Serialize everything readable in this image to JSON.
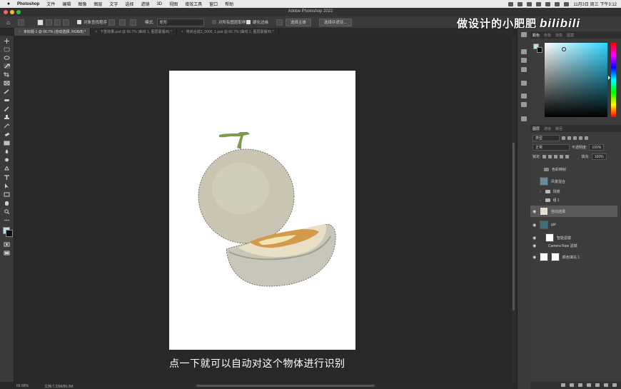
{
  "menubar": {
    "app": "Photoshop",
    "items": [
      "文件",
      "编辑",
      "图像",
      "图层",
      "文字",
      "选择",
      "滤镜",
      "3D",
      "视图",
      "增效工具",
      "窗口",
      "帮助"
    ],
    "clock": "11月3日 周三 下午3:12"
  },
  "window": {
    "title": "Adobe Photoshop 2022"
  },
  "options_bar": {
    "object_finder": "对象查找程序",
    "mode_label": "模式:",
    "mode_value": "矩形",
    "sample_all": "对所有图层取样",
    "harden_edge": "硬化边缘",
    "select_subject": "选择主体",
    "select_mask": "选择并遮住..."
  },
  "tabs": [
    {
      "label": "未标题-1 @ 66.7% (自动选择, RGB/8) *",
      "active": true
    },
    {
      "label": "下雪效果.psd @ 66.7% (曲线 1, 图层蒙版/8) *",
      "active": false
    },
    {
      "label": "电商合成2_0000_1.psd @ 66.7% (曲线 1, 图层蒙版/8) *",
      "active": false
    }
  ],
  "canvas": {
    "subtitle": "点一下就可以自动对这个物体进行识别"
  },
  "status": {
    "zoom": "66.68%",
    "doc": "文档:7.23M/89.0M"
  },
  "watermark": {
    "text": "做设计的小肥肥",
    "logo": "bilibili"
  },
  "color_panel": {
    "tabs": [
      "颜色",
      "色板",
      "渐变",
      "图案"
    ],
    "foreground": "#b8e2ec",
    "background": "#111111"
  },
  "layers_panel": {
    "tabs": [
      "图层",
      "通道",
      "路径"
    ],
    "filter_kind": "类型",
    "blend_mode": "正常",
    "opacity_label": "不透明度:",
    "opacity_value": "100%",
    "lock_label": "锁定:",
    "fill_label": "填充:",
    "fill_value": "100%",
    "layers": [
      {
        "name": "色彩映射",
        "kind": "adjust",
        "visible": false
      },
      {
        "name": "风景混合",
        "kind": "image",
        "visible": false
      },
      {
        "name": "场景",
        "kind": "folder",
        "visible": false
      },
      {
        "name": "组 1",
        "kind": "folder",
        "visible": false
      },
      {
        "name": "自动选择",
        "kind": "image",
        "visible": true,
        "selected": true
      },
      {
        "name": "girl",
        "kind": "smart",
        "visible": true
      },
      {
        "name": "智能滤镜",
        "kind": "filtermask",
        "visible": true
      },
      {
        "name": "Camera Raw 滤镜",
        "kind": "filter",
        "visible": true
      },
      {
        "name": "颜色填充 1",
        "kind": "fill",
        "visible": true
      }
    ]
  }
}
